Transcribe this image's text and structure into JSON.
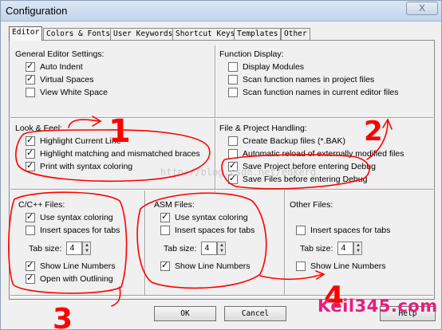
{
  "window": {
    "title": "Configuration",
    "close_label": "X"
  },
  "tabs": [
    {
      "label": "Editor"
    },
    {
      "label": "Colors & Fonts"
    },
    {
      "label": "User Keywords"
    },
    {
      "label": "Shortcut Keys"
    },
    {
      "label": "Templates"
    },
    {
      "label": "Other"
    }
  ],
  "general": {
    "label": "General Editor Settings:",
    "options": [
      {
        "label": "Auto Indent",
        "checked": true
      },
      {
        "label": "Virtual Spaces",
        "checked": true
      },
      {
        "label": "View White Space",
        "checked": false
      }
    ]
  },
  "function_display": {
    "label": "Function Display:",
    "options": [
      {
        "label": "Display Modules",
        "checked": false
      },
      {
        "label": "Scan function names in project files",
        "checked": false
      },
      {
        "label": "Scan function names in current editor files",
        "checked": false
      }
    ]
  },
  "look_feel": {
    "label": "Look & Feel:",
    "options": [
      {
        "label": "Highlight Current Line",
        "checked": true
      },
      {
        "label": "Highlight matching and mismatched braces",
        "checked": true
      },
      {
        "label": "Print with syntax coloring",
        "checked": true
      }
    ]
  },
  "file_project": {
    "label": "File & Project Handling:",
    "options": [
      {
        "label": "Create Backup files (*.BAK)",
        "checked": false
      },
      {
        "label": "Automatic reload of externally modified files",
        "checked": false
      },
      {
        "label": "Save Project before entering Debug",
        "checked": true
      },
      {
        "label": "Save Files before entering Debug",
        "checked": true
      }
    ]
  },
  "c_files": {
    "label": "C/C++ Files:",
    "use_syntax": {
      "label": "Use syntax coloring",
      "checked": true
    },
    "insert_spaces": {
      "label": "Insert spaces for tabs",
      "checked": false
    },
    "tab_size_label": "Tab size:",
    "tab_size": "4",
    "show_line_numbers": {
      "label": "Show Line Numbers",
      "checked": true
    },
    "open_outlining": {
      "label": "Open with Outlining",
      "checked": true
    }
  },
  "asm_files": {
    "label": "ASM Files:",
    "use_syntax": {
      "label": "Use syntax coloring",
      "checked": true
    },
    "insert_spaces": {
      "label": "Insert spaces for tabs",
      "checked": false
    },
    "tab_size_label": "Tab size:",
    "tab_size": "4",
    "show_line_numbers": {
      "label": "Show Line Numbers",
      "checked": true
    }
  },
  "other_files": {
    "label": "Other Files:",
    "insert_spaces": {
      "label": "Insert spaces for tabs",
      "checked": false
    },
    "tab_size_label": "Tab size:",
    "tab_size": "4",
    "show_line_numbers": {
      "label": "Show Line Numbers",
      "checked": false
    }
  },
  "buttons": {
    "ok": "OK",
    "cancel": "Cancel",
    "help": "Help"
  },
  "annotations": {
    "numbers": [
      "1",
      "2",
      "3",
      "4"
    ],
    "color": "#ff0000",
    "blog_text": "http://blog.csdn.net/edkerg",
    "watermark": "Keil345.com",
    "watermark_color": "#e81d7e"
  }
}
